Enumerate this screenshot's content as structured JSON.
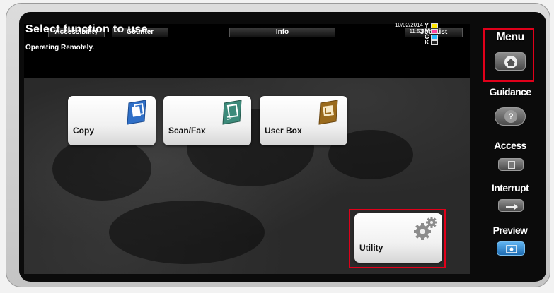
{
  "tabs": {
    "accessibility": "Accessibility",
    "counter": "Counter",
    "info": "Info",
    "job_list": "Job List"
  },
  "header": {
    "title": "Select function to use.",
    "status": "Operating Remotely.",
    "date": "10/02/2014",
    "time": "11:53"
  },
  "toner": [
    {
      "letter": "Y",
      "color": "#ffe600"
    },
    {
      "letter": "M",
      "color": "#ff3fa0"
    },
    {
      "letter": "C",
      "color": "#2ab8ff"
    },
    {
      "letter": "K",
      "color": "#222222"
    }
  ],
  "functions": {
    "copy": {
      "label": "Copy",
      "icon": "copy-icon",
      "color": "#2f6fc7"
    },
    "scan_fax": {
      "label": "Scan/Fax",
      "icon": "scan-fax-icon",
      "color": "#3c8a7a"
    },
    "user_box": {
      "label": "User Box",
      "icon": "user-box-icon",
      "color": "#9a6a1c"
    },
    "utility": {
      "label": "Utility",
      "icon": "gear-icon",
      "color": "#8c8c8c"
    }
  },
  "side_panel": {
    "menu": "Menu",
    "guidance": "Guidance",
    "access": "Access",
    "interrupt": "Interrupt",
    "preview": "Preview"
  },
  "highlight_color": "#e0001a"
}
